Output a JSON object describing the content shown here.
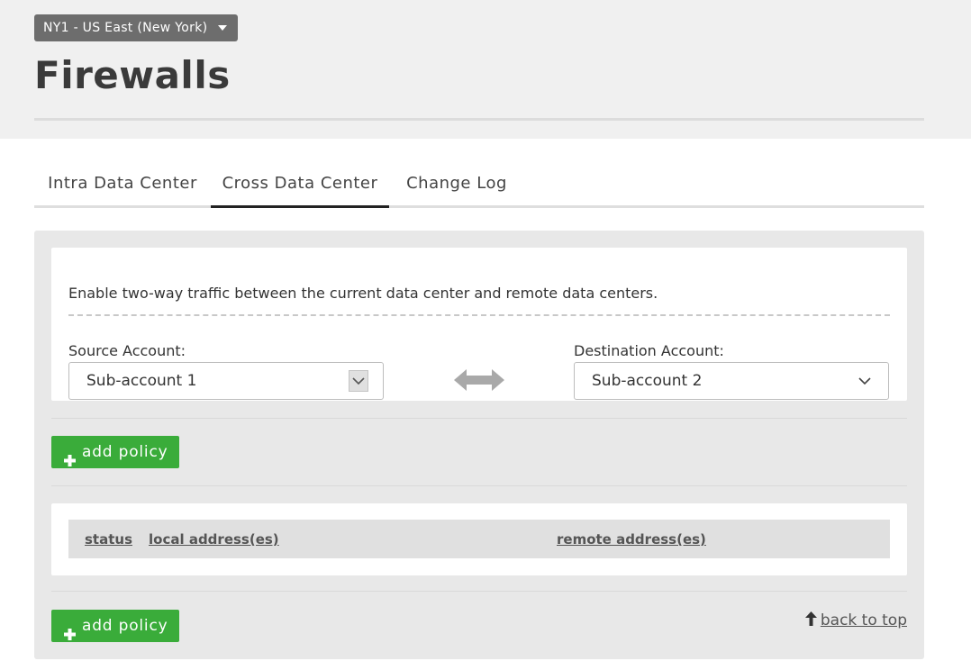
{
  "header": {
    "datacenter_selector": "NY1 - US East (New York)",
    "title": "Firewalls"
  },
  "tabs": [
    {
      "label": "Intra Data Center",
      "active": false
    },
    {
      "label": "Cross Data Center",
      "active": true
    },
    {
      "label": "Change Log",
      "active": false
    }
  ],
  "accounts_card": {
    "description": "Enable two-way traffic between the current data center and remote data centers.",
    "source": {
      "label": "Source Account:",
      "value": "Sub-account 1"
    },
    "destination": {
      "label": "Destination Account:",
      "value": "Sub-account 2"
    }
  },
  "policies": {
    "add_label": "add policy",
    "columns": [
      "status",
      "local address(es)",
      "remote address(es)"
    ]
  },
  "footer": {
    "back_to_top": "back to top"
  },
  "colors": {
    "accent_green": "#3aac3a",
    "header_bg": "#f0f0f0",
    "panel_bg": "#e8e8e8"
  }
}
